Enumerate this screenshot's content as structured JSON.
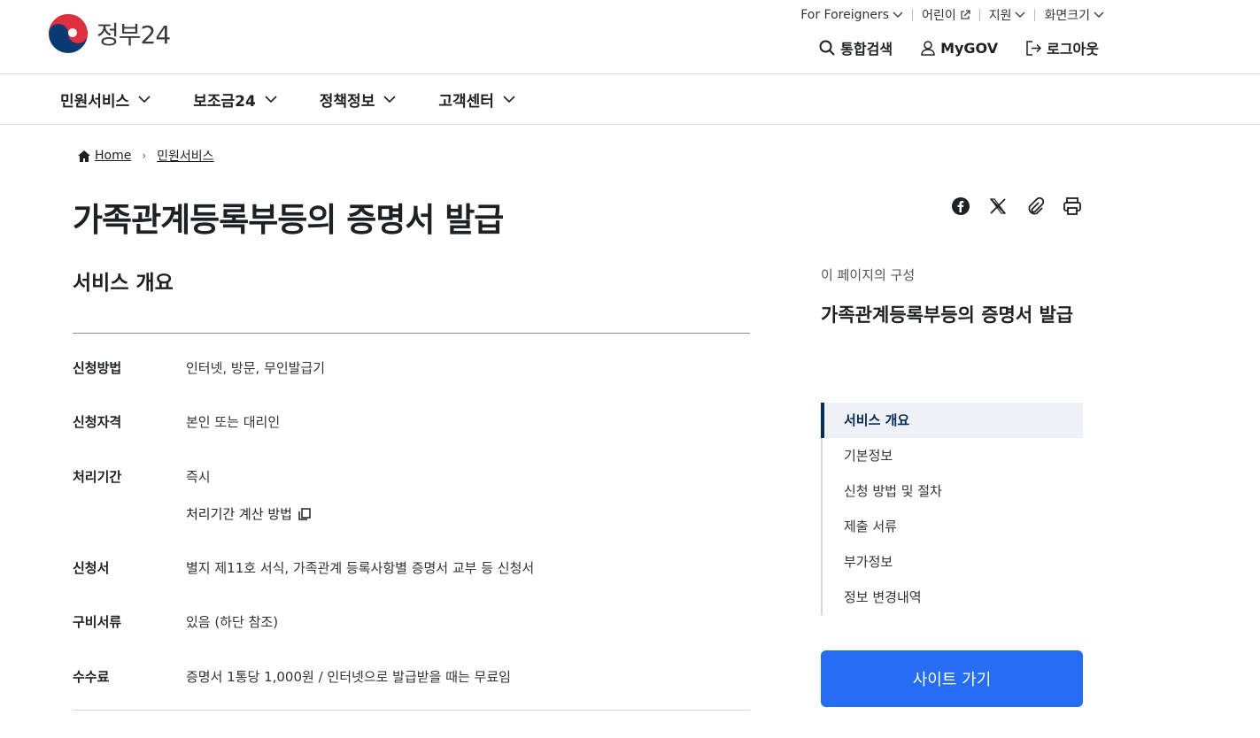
{
  "logo": {
    "text": "정부24"
  },
  "util_nav": [
    {
      "label": "For Foreigners",
      "icon": "chevron-down-icon"
    },
    {
      "label": "어린이",
      "icon": "external-link-icon"
    },
    {
      "label": "지원",
      "icon": "chevron-down-icon"
    },
    {
      "label": "화면크기",
      "icon": "chevron-down-icon"
    }
  ],
  "actions": {
    "search": "통합검색",
    "mygov": "MyGOV",
    "logout": "로그아웃"
  },
  "gnb": [
    {
      "label": "민원서비스"
    },
    {
      "label": "보조금24"
    },
    {
      "label": "정책정보"
    },
    {
      "label": "고객센터"
    }
  ],
  "breadcrumb": {
    "home": "Home",
    "current": "민원서비스"
  },
  "page_title": "가족관계등록부등의 증명서 발급",
  "share_icons": [
    "facebook-icon",
    "x-icon",
    "clip-icon",
    "print-icon"
  ],
  "section": {
    "title": "서비스 개요",
    "rows": [
      {
        "label": "신청방법",
        "value": "인터넷, 방문, 무인발급기"
      },
      {
        "label": "신청자격",
        "value": "본인 또는 대리인"
      },
      {
        "label": "처리기간",
        "value": "즉시"
      },
      {
        "label": "신청서",
        "value": "별지 제11호 서식, 가족관계 등록사항별 증명서 교부 등 신청서"
      },
      {
        "label": "구비서류",
        "value": "있음 (하단 참조)"
      },
      {
        "label": "수수료",
        "value": "증명서 1통당 1,000원 / 인터넷으로 발급받을 때는 무료임"
      }
    ],
    "period_link": "처리기간 계산 방법"
  },
  "side": {
    "caption": "이 페이지의 구성",
    "title": "가족관계등록부등의 증명서 발급",
    "toc": [
      {
        "label": "서비스 개요",
        "active": true
      },
      {
        "label": "기본정보"
      },
      {
        "label": "신청 방법 및 절차"
      },
      {
        "label": "제출 서류"
      },
      {
        "label": "부가정보"
      },
      {
        "label": "정보 변경내역"
      }
    ],
    "site_button": "사이트 가기"
  },
  "colors": {
    "primary": "#256ef4",
    "navy": "#052b57",
    "logo_red": "#e03040",
    "logo_blue": "#0b3a73"
  }
}
